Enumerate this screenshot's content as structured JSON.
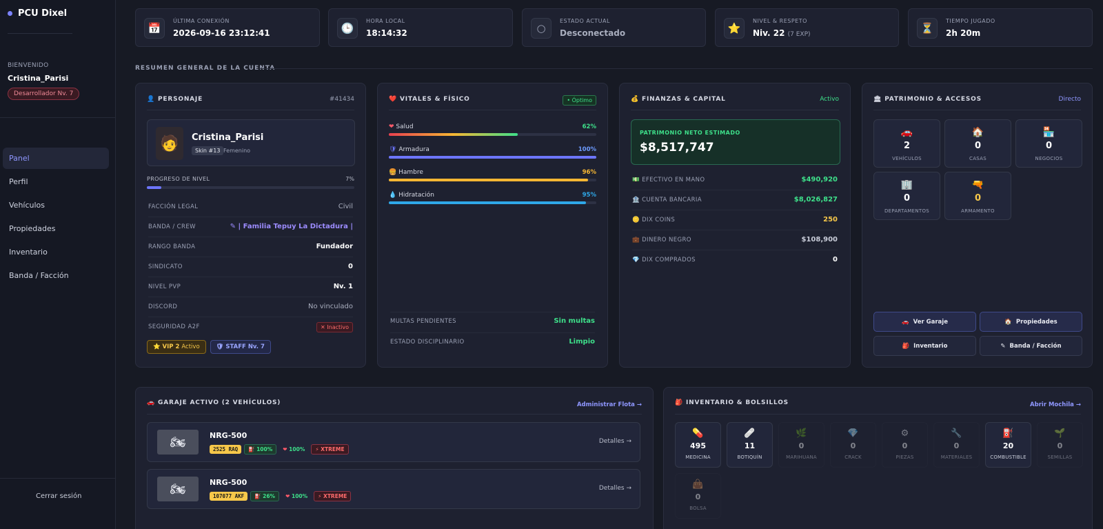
{
  "brand": "PCU Dixel",
  "welcome": {
    "label": "BIENVENIDO",
    "name": "Cristina_Parisi",
    "role": "Desarrollador Nv. 7"
  },
  "nav": [
    "Panel",
    "Perfil",
    "Vehículos",
    "Propiedades",
    "Inventario",
    "Banda / Facción"
  ],
  "logout": "Cerrar sesión",
  "stats": [
    {
      "icon": "📅",
      "label": "ÚLTIMA CONEXIÓN",
      "value": "2026-09-16 23:12:41"
    },
    {
      "icon": "🕒",
      "label": "HORA LOCAL",
      "value": "18:14:32"
    },
    {
      "icon": "○",
      "label": "ESTADO ACTUAL",
      "value": "Desconectado"
    },
    {
      "icon": "⭐",
      "label": "NIVEL & RESPETO",
      "value": "Niv. 22",
      "sub": "(7 EXP)"
    },
    {
      "icon": "⏳",
      "label": "TIEMPO JUGADO",
      "value": "2h 20m"
    }
  ],
  "section_title": "RESUMEN GENERAL DE LA CUENTA",
  "personaje": {
    "title": "PERSONAJE",
    "id": "#41434",
    "name": "Cristina_Parisi",
    "skin": "Skin #13",
    "gender": "Femenino",
    "progress_label": "PROGRESO DE NIVEL",
    "progress_value": "7%",
    "progress": 7,
    "rows": [
      {
        "k": "FACCIÓN LEGAL",
        "v": "Civil"
      },
      {
        "k": "BANDA / CREW",
        "v": "✎ | Familia Tepuy La Dictadura |"
      },
      {
        "k": "RANGO BANDA",
        "v": "Fundador"
      },
      {
        "k": "SINDICATO",
        "v": "0"
      },
      {
        "k": "NIVEL PVP",
        "v": "Nv. 1"
      },
      {
        "k": "DISCORD",
        "v": "No vinculado"
      },
      {
        "k": "SEGURIDAD A2F",
        "v": "✕ Inactivo"
      }
    ],
    "vip_label": "VIP 2",
    "vip_state": "Activo",
    "staff": "STAFF Nv. 7"
  },
  "vitales": {
    "title": "VITALES & FÍSICO",
    "status": "• Óptimo",
    "items": [
      {
        "icon": "❤",
        "name": "Salud",
        "value": "62%",
        "pct": 62,
        "color": "#3ee08a"
      },
      {
        "icon": "🛡",
        "name": "Armadura",
        "value": "100%",
        "pct": 100,
        "color": "#6d76ff"
      },
      {
        "icon": "🍔",
        "name": "Hambre",
        "value": "96%",
        "pct": 96,
        "color": "#f7b733"
      },
      {
        "icon": "💧",
        "name": "Hidratación",
        "value": "95%",
        "pct": 95,
        "color": "#2fa8e8"
      }
    ],
    "multas_label": "MULTAS PENDIENTES",
    "multas_value": "Sin multas",
    "disc_label": "ESTADO DISCIPLINARIO",
    "disc_value": "Limpio"
  },
  "finanzas": {
    "title": "FINANZAS & CAPITAL",
    "status": "Activo",
    "net_label": "PATRIMONIO NETO ESTIMADO",
    "net_value": "$8,517,747",
    "rows": [
      {
        "icon": "💵",
        "k": "EFECTIVO EN MANO",
        "v": "$490,920",
        "color": "#3ee08a"
      },
      {
        "icon": "🏦",
        "k": "CUENTA BANCARIA",
        "v": "$8,026,827",
        "color": "#3ee08a"
      },
      {
        "icon": "🪙",
        "k": "DIX COINS",
        "v": "250",
        "color": "#f7c84a"
      },
      {
        "icon": "💼",
        "k": "DINERO NEGRO",
        "v": "$108,900",
        "color": "#c8ccd8"
      },
      {
        "icon": "💎",
        "k": "DIX COMPRADOS",
        "v": "0",
        "color": "#ffffff"
      }
    ]
  },
  "patrimonio": {
    "title": "PATRIMONIO & ACCESOS",
    "status": "Directo",
    "assets": [
      {
        "icon": "🚗",
        "n": "2",
        "l": "VEHÍCULOS",
        "color": "#ffffff"
      },
      {
        "icon": "🏠",
        "n": "0",
        "l": "CASAS",
        "color": "#ffffff"
      },
      {
        "icon": "🏪",
        "n": "0",
        "l": "NEGOCIOS",
        "color": "#ffffff"
      },
      {
        "icon": "🏢",
        "n": "0",
        "l": "DEPARTAMENTOS",
        "color": "#ffffff"
      },
      {
        "icon": "🔫",
        "n": "0",
        "l": "ARMAMENTO",
        "color": "#f7c84a"
      }
    ],
    "buttons": [
      {
        "icon": "🚗",
        "label": "Ver Garaje"
      },
      {
        "icon": "🏠",
        "label": "Propiedades"
      },
      {
        "icon": "🎒",
        "label": "Inventario"
      },
      {
        "icon": "✎",
        "label": "Banda / Facción"
      }
    ]
  },
  "garaje": {
    "title": "GARAJE ACTIVO (2 VEHÍCULOS)",
    "link": "Administrar Flota →",
    "vehicles": [
      {
        "name": "NRG-500",
        "plate": "2525 RAQ",
        "fuel": "100%",
        "hp": "100%",
        "tier": "⚡ XTREME",
        "details": "Detalles →"
      },
      {
        "name": "NRG-500",
        "plate": "107077 AKF",
        "fuel": "26%",
        "hp": "100%",
        "tier": "⚡ XTREME",
        "details": "Detalles →"
      }
    ]
  },
  "inventario": {
    "title": "INVENTARIO & BOLSILLOS",
    "link": "Abrir Mochila →",
    "items": [
      {
        "icon": "💊",
        "n": "495",
        "l": "MEDICINA",
        "dim": false
      },
      {
        "icon": "🩹",
        "n": "11",
        "l": "BOTIQUÍN",
        "dim": false
      },
      {
        "icon": "🌿",
        "n": "0",
        "l": "MARIHUANA",
        "dim": true
      },
      {
        "icon": "💎",
        "n": "0",
        "l": "CRACK",
        "dim": true
      },
      {
        "icon": "⚙",
        "n": "0",
        "l": "PIEZAS",
        "dim": true
      },
      {
        "icon": "🔧",
        "n": "0",
        "l": "MATERIALES",
        "dim": true
      },
      {
        "icon": "⛽",
        "n": "20",
        "l": "COMBUSTIBLE",
        "dim": false
      },
      {
        "icon": "🌱",
        "n": "0",
        "l": "SEMILLAS",
        "dim": true
      },
      {
        "icon": "👜",
        "n": "0",
        "l": "BOLSA",
        "dim": true
      }
    ]
  }
}
